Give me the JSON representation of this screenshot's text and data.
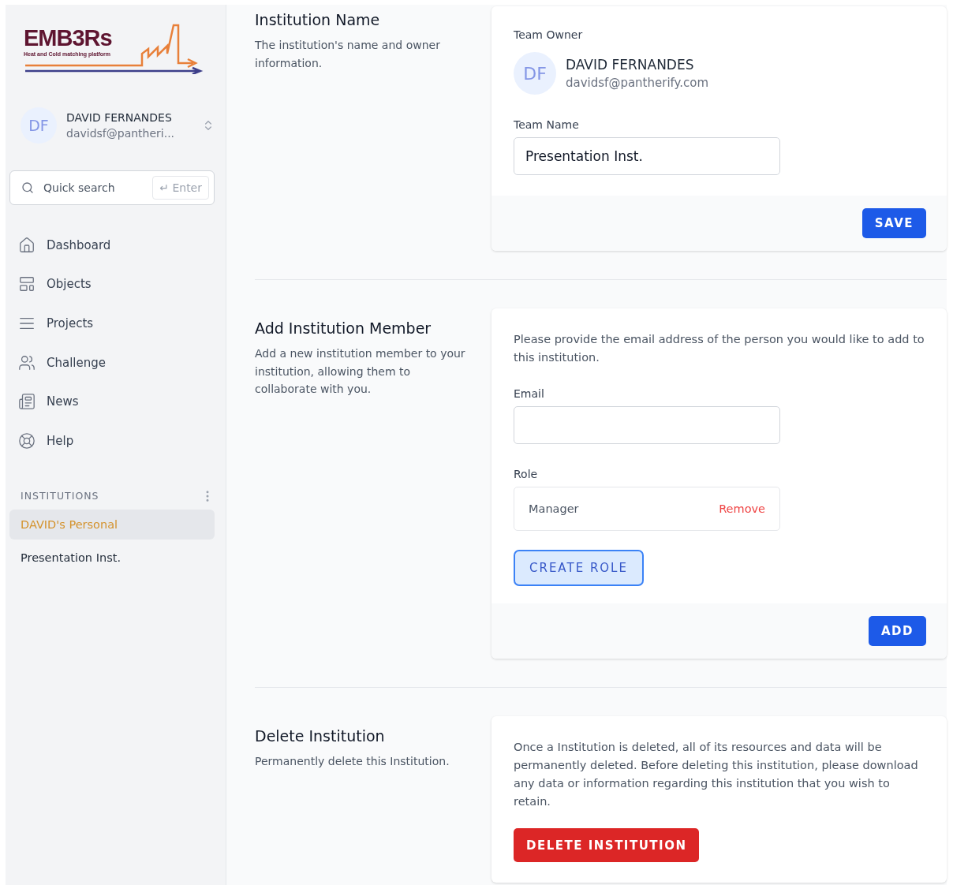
{
  "logo": {
    "title": "EMB3Rs",
    "subtitle": "Heat and Cold matching platform"
  },
  "user": {
    "initials": "DF",
    "name": "DAVID FERNANDES",
    "email": "davidsf@pantheri..."
  },
  "search": {
    "placeholder": "Quick search",
    "shortcut": "↵ Enter"
  },
  "nav": [
    {
      "label": "Dashboard"
    },
    {
      "label": "Objects"
    },
    {
      "label": "Projects"
    },
    {
      "label": "Challenge"
    },
    {
      "label": "News"
    },
    {
      "label": "Help"
    }
  ],
  "institutions": {
    "heading": "INSTITUTIONS",
    "items": [
      {
        "label": "DAVID's Personal",
        "selected": true
      },
      {
        "label": "Presentation Inst.",
        "selected": false
      }
    ]
  },
  "sections": [
    {
      "kind": "name",
      "title": "Institution Name",
      "description": "The institution's name and owner information.",
      "owner_label": "Team Owner",
      "owner": {
        "initials": "DF",
        "name": "DAVID FERNANDES",
        "email": "davidsf@pantherify.com"
      },
      "field_label": "Team Name",
      "field_value": "Presentation Inst.",
      "button": "SAVE"
    },
    {
      "kind": "member",
      "title": "Add Institution Member",
      "description": "Add a new institution member to your institution, allowing them to collaborate with you.",
      "intro": "Please provide the email address of the person you would like to add to this institution.",
      "email_label": "Email",
      "role_label": "Role",
      "role": {
        "name": "Manager",
        "action": "Remove"
      },
      "create_button": "CREATE ROLE",
      "button": "ADD"
    },
    {
      "kind": "delete",
      "title": "Delete Institution",
      "description": "Permanently delete this Institution.",
      "warning": "Once a Institution is deleted, all of its resources and data will be permanently deleted. Before deleting this institution, please download any data or information regarding this institution that you wish to retain.",
      "button": "DELETE INSTITUTION"
    }
  ]
}
